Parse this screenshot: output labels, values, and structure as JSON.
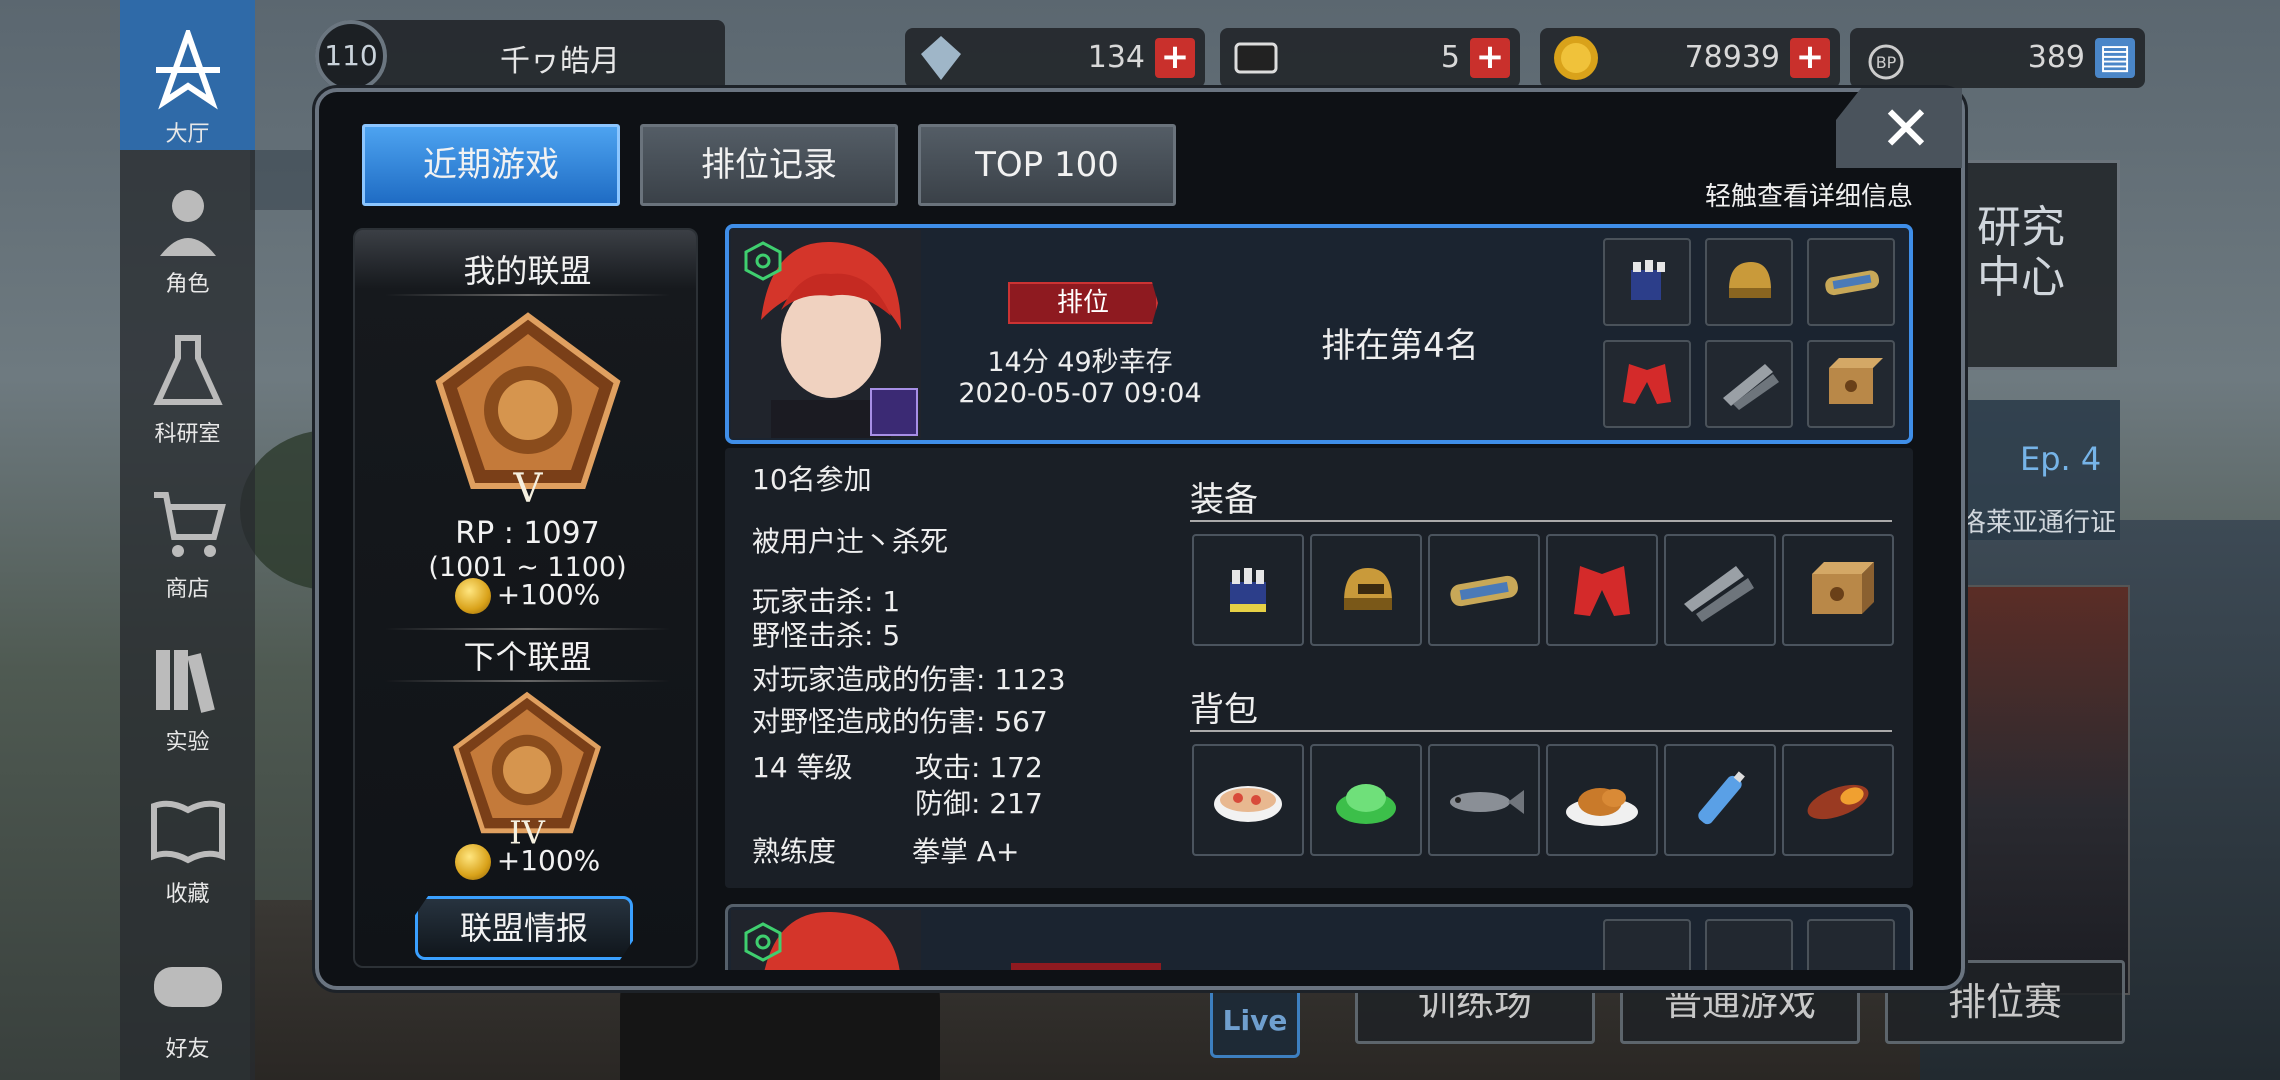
{
  "nav": {
    "items": [
      {
        "label": "大厅"
      },
      {
        "label": "角色"
      },
      {
        "label": "科研室"
      },
      {
        "label": "商店"
      },
      {
        "label": "实验"
      },
      {
        "label": "收藏"
      },
      {
        "label": "好友"
      }
    ]
  },
  "topbar": {
    "level": "110",
    "player_name": "千ヮ皓月",
    "currencies": [
      {
        "name": "crystal",
        "value": "134"
      },
      {
        "name": "ticket",
        "value": "5"
      },
      {
        "name": "gold-coin",
        "value": "78939"
      },
      {
        "name": "bp",
        "icon_text": "BP",
        "value": "389"
      }
    ]
  },
  "background": {
    "research_center": "研究\n中心",
    "pass_episode": "Ep. 4",
    "pass_label": "洛莱亚通行证",
    "modes": [
      "训练场",
      "普通游戏",
      "排位赛"
    ],
    "live": "Live"
  },
  "modal": {
    "tabs": [
      "近期游戏",
      "排位记录",
      "TOP 100"
    ],
    "hint": "轻触查看详细信息",
    "league": {
      "my_league_title": "我的联盟",
      "my_league_tier": "V",
      "rp": "RP : 1097",
      "rp_range": "(1001 ~ 1100)",
      "my_bonus": "+100%",
      "next_league_title": "下个联盟",
      "next_league_tier": "IV",
      "next_bonus": "+100%",
      "info_button": "联盟情报"
    },
    "match": {
      "mode_badge": "排位",
      "survival": "14分 49秒幸存",
      "datetime": "2020-05-07 09:04",
      "placement": "排在第4名",
      "participants": "10名参加",
      "killed_by": "被用户辻丶杀死",
      "player_kills": "玩家击杀: 1",
      "monster_kills": "野怪击杀: 5",
      "damage_to_players": "对玩家造成的伤害: 1123",
      "damage_to_monsters": "对野怪造成的伤害: 567",
      "level": "14 等级",
      "attack": "攻击: 172",
      "defense": "防御: 217",
      "proficiency_label": "熟练度",
      "proficiency_value": "拳掌 A+",
      "equipment_title": "装备",
      "equipment": [
        "glove-icon",
        "helmet-icon",
        "bracer-icon",
        "jacket-icon",
        "boots-icon",
        "box-icon"
      ],
      "backpack_title": "背包",
      "backpack": [
        "ramen-icon",
        "herb-icon",
        "fish-icon",
        "fried-chicken-icon",
        "water-bottle-icon",
        "sweet-potato-icon"
      ]
    }
  },
  "colors": {
    "accent_blue": "#2f8bec",
    "rank_red": "#8e1a20",
    "add_red": "#c9302c"
  }
}
